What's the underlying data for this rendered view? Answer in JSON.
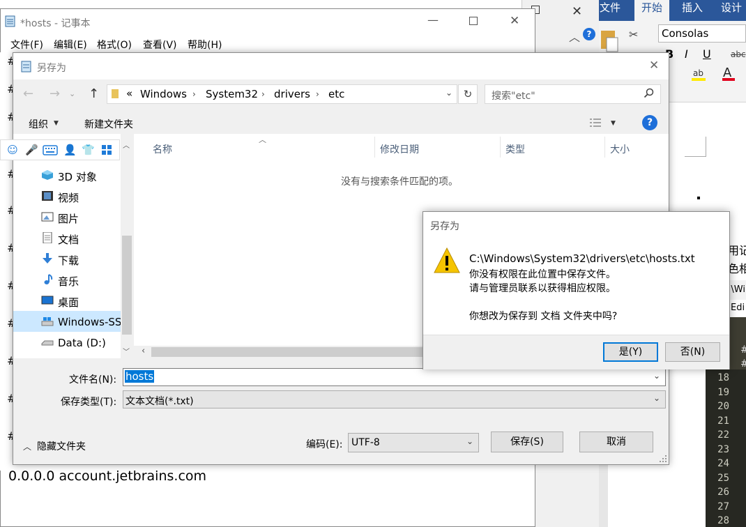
{
  "word": {
    "tabs": [
      "文件",
      "开始",
      "插入",
      "设计"
    ],
    "font_name": "Consolas",
    "format_buttons": [
      "B",
      "I",
      "U",
      "abc"
    ],
    "fragments": [
      "用记",
      "色相",
      ":\\Wi",
      "Edi",
      "#",
      "#",
      "#",
      "#"
    ]
  },
  "editor": {
    "line_numbers": [
      "18",
      "19",
      "20",
      "21",
      "22",
      "23",
      "24",
      "25",
      "26",
      "27",
      "28"
    ]
  },
  "notepad": {
    "title": "*hosts - 记事本",
    "menu": [
      "文件(F)",
      "编辑(E)",
      "格式(O)",
      "查看(V)",
      "帮助(H)"
    ],
    "content_line": "0.0.0.0 account.jetbrains.com"
  },
  "saveas": {
    "title": "另存为",
    "breadcrumb": [
      "«",
      "Windows",
      "System32",
      "drivers",
      "etc"
    ],
    "search_placeholder": "搜索\"etc\"",
    "toolbar": {
      "organize": "组织",
      "new_folder": "新建文件夹"
    },
    "nav_items": [
      "3D 对象",
      "视频",
      "图片",
      "文档",
      "下载",
      "音乐",
      "桌面",
      "Windows-SS",
      "Data (D:)"
    ],
    "columns": [
      "名称",
      "修改日期",
      "类型",
      "大小"
    ],
    "empty_message": "没有与搜索条件匹配的项。",
    "filename_label": "文件名(N):",
    "filename_value": "hosts",
    "filetype_label": "保存类型(T):",
    "filetype_value": "文本文档(*.txt)",
    "hide_folders": "隐藏文件夹",
    "encoding_label": "编码(E):",
    "encoding_value": "UTF-8",
    "save_button": "保存(S)",
    "cancel_button": "取消"
  },
  "msgbox": {
    "title": "另存为",
    "path": "C:\\Windows\\System32\\drivers\\etc\\hosts.txt",
    "line1": "你没有权限在此位置中保存文件。",
    "line2": "请与管理员联系以获得相应权限。",
    "question": "你想改为保存到 文档 文件夹中吗?",
    "yes_button": "是(Y)",
    "no_button": "否(N)"
  },
  "colors": {
    "word_blue": "#2b579a",
    "selection": "#0078d7",
    "warning": "#f5c400",
    "help_blue": "#1e6fd9"
  }
}
